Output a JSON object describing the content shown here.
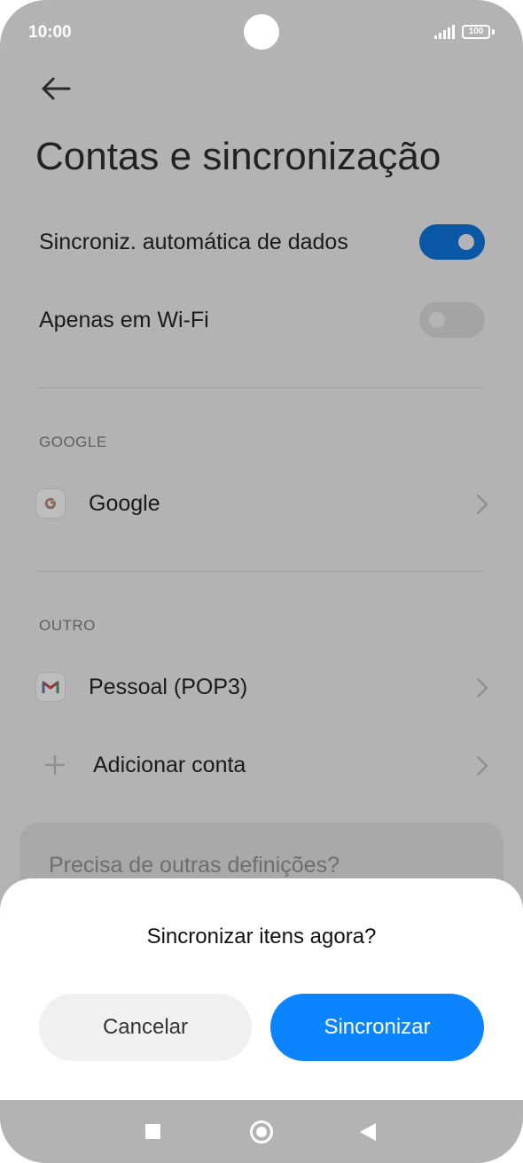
{
  "status_bar": {
    "time": "10:00",
    "battery": "100",
    "signal_icon": "signal-bars-icon",
    "battery_icon": "battery-icon"
  },
  "header": {
    "back_icon": "arrow-left-icon",
    "title": "Contas e sincronização"
  },
  "settings": {
    "auto_sync": {
      "label": "Sincroniz. automática de dados",
      "on": true
    },
    "wifi_only": {
      "label": "Apenas em Wi-Fi",
      "on": false
    }
  },
  "sections": {
    "google": {
      "header": "GOOGLE",
      "accounts": [
        {
          "label": "Google",
          "icon": "google-icon"
        }
      ]
    },
    "other": {
      "header": "OUTRO",
      "accounts": [
        {
          "label": "Pessoal (POP3)",
          "icon": "gmail-icon"
        }
      ],
      "add_account": {
        "label": "Adicionar conta",
        "icon": "plus-icon"
      }
    }
  },
  "help_card": {
    "text": "Precisa de outras definições?"
  },
  "dialog": {
    "title": "Sincronizar itens agora?",
    "cancel_label": "Cancelar",
    "confirm_label": "Sincronizar"
  },
  "nav_bar": {
    "recents_icon": "square-icon",
    "home_icon": "circle-icon",
    "back_icon": "triangle-back-icon"
  },
  "colors": {
    "scrim": "#b3b3b3",
    "accent": "#0d84ff",
    "toggle_on_dimmed": "#0a57a6",
    "sheet_background": "#ffffff"
  }
}
